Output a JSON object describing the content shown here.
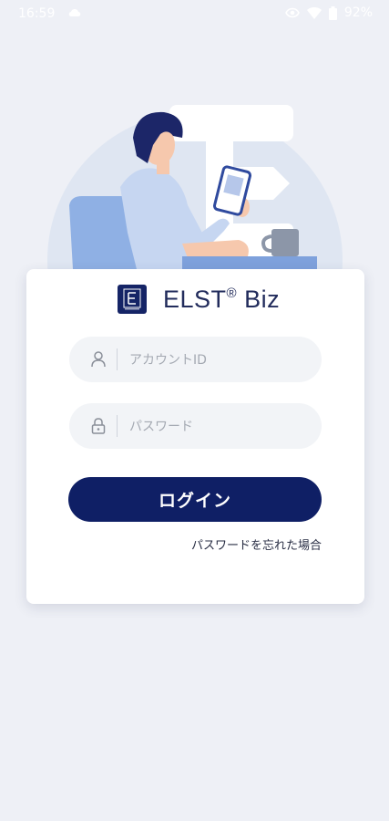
{
  "status_bar": {
    "time": "16:59",
    "battery": "92%",
    "icons": [
      "cloud-icon",
      "eye-icon",
      "wifi-icon",
      "battery-icon"
    ]
  },
  "brand": {
    "name": "ELST",
    "registered": "®",
    "suffix": " Biz",
    "logo_color": "#152466"
  },
  "login": {
    "account_placeholder": "アカウントID",
    "password_placeholder": "パスワード",
    "login_button": "ログイン",
    "forgot_password": "パスワードを忘れた場合"
  },
  "colors": {
    "background": "#eef0f6",
    "primary": "#0f1f65",
    "input_bg": "#f2f4f7"
  }
}
